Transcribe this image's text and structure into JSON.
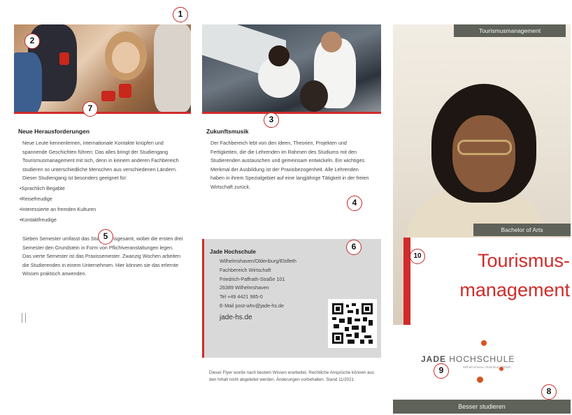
{
  "left": {
    "heading": "Neue Herausforderungen",
    "para1": "Neue Leute kennenlernen, internationale Kontakte knüpfen und spannende Geschichten führen: Das alles bringt der Studiengang Tourismusmanagement mit sich, denn in keinem anderen Fachbereich studieren so unterschiedliche Menschen aus verschiedenen Ländern. Dieser Studiengang ist besonders geeignet für:",
    "bullets": [
      "Sprachlich Begabte",
      "Reisefreudige",
      "Interessierte an fremden Kulturen",
      "Kontaktfreudige"
    ],
    "para2": "Sieben Semester umfasst das Studium insgesamt, wobei die ersten drei Semester den Grundstein in Form von Pflichtveranstaltungen legen. Das vierte Semester ist das Praxissemester. Zwanzig Wochen arbeiten die Studierenden in einem Unternehmen. Hier können sie das erlernte Wissen praktisch anwenden."
  },
  "middle": {
    "heading": "Zukunftsmusik",
    "para": "Der Fachbereich lebt von den Ideen, Theorien, Projekten und Fertigkeiten, die die Lehrenden im Rahmen des Studiums mit den Studierenden austauschen und gemeinsam entwickeln. Ein wichtiges Merkmal der Ausbildung ist der Praxisbezogenheit. Alle Lehrenden haben in ihrem Spezialgebiet auf eine langjährige Tätigkeit in der freien Wirtschaft zurück."
  },
  "contact": {
    "title": "Jade Hochschule",
    "lines": [
      "Wilhelmshaven/Oldenburg/Elsfleth",
      "Fachbereich Wirtschaft",
      "Friedrich-Paffrath-Straße 101",
      "26389 Wilhelmshaven",
      "Tel +49 4421 985-0",
      "E-Mail post-whv@jade-hs.de"
    ],
    "url": "jade-hs.de"
  },
  "footnote": "Dieser Flyer wurde nach bestem Wissen erarbeitet. Rechtliche Ansprüche können aus den Inhalt nicht abgeleitet werden. Änderungen vorbehalten. Stand 11/2021",
  "cover": {
    "top_tag": "Tourismusmanagement",
    "degree_tag": "Bachelor of Arts",
    "title_line1": "Tourismus-",
    "title_line2": "management",
    "logo_jade": "JADE",
    "logo_rest": "HOCHSCHULE",
    "logo_sub": "Wilhelmshaven Oldenburg Elsfleth",
    "bottom_tag": "Besser studieren"
  },
  "markers": [
    "1",
    "2",
    "3",
    "4",
    "5",
    "6",
    "7",
    "8",
    "9",
    "10"
  ],
  "colors": {
    "accent": "#d12b2b",
    "tag_bg": "#5e6259",
    "contact_bg": "#d9d9d9"
  }
}
